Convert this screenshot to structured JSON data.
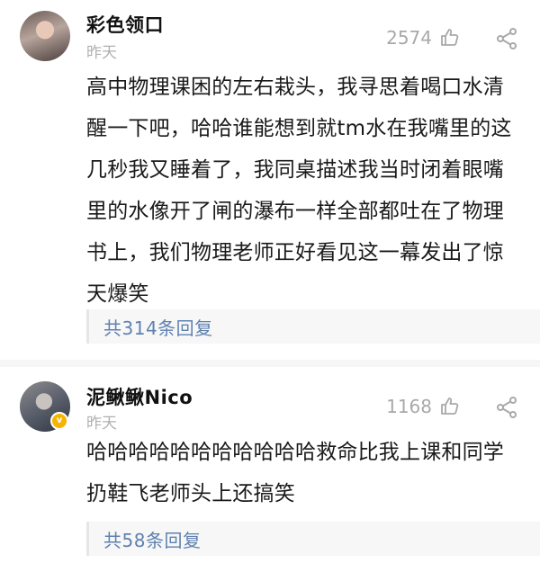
{
  "comments": [
    {
      "username": "彩色领口",
      "time": "昨天",
      "likes": "2574",
      "text": "高中物理课困的左右栽头，我寻思着喝口水清醒一下吧，哈哈谁能想到就tm水在我嘴里的这几秒我又睡着了，我同桌描述我当时闭着眼嘴里的水像开了闸的瀑布一样全部都吐在了物理书上，我们物理老师正好看见这一幕发出了惊天爆笑",
      "replies": "共314条回复",
      "avatar_icon": "user-avatar",
      "verified": false
    },
    {
      "username": "泥鳅鳅Nico",
      "time": "昨天",
      "likes": "1168",
      "text": "哈哈哈哈哈哈哈哈哈哈哈救命比我上课和同学扔鞋飞老师头上还搞笑",
      "replies": "共58条回复",
      "avatar_icon": "user-avatar",
      "verified": true,
      "badge_text": "v"
    }
  ],
  "icons": {
    "like": "thumbs-up-icon",
    "share": "share-icon"
  },
  "colors": {
    "reply_link": "#5f81b0",
    "muted": "#a9a9a9",
    "badge": "#f5b400"
  }
}
